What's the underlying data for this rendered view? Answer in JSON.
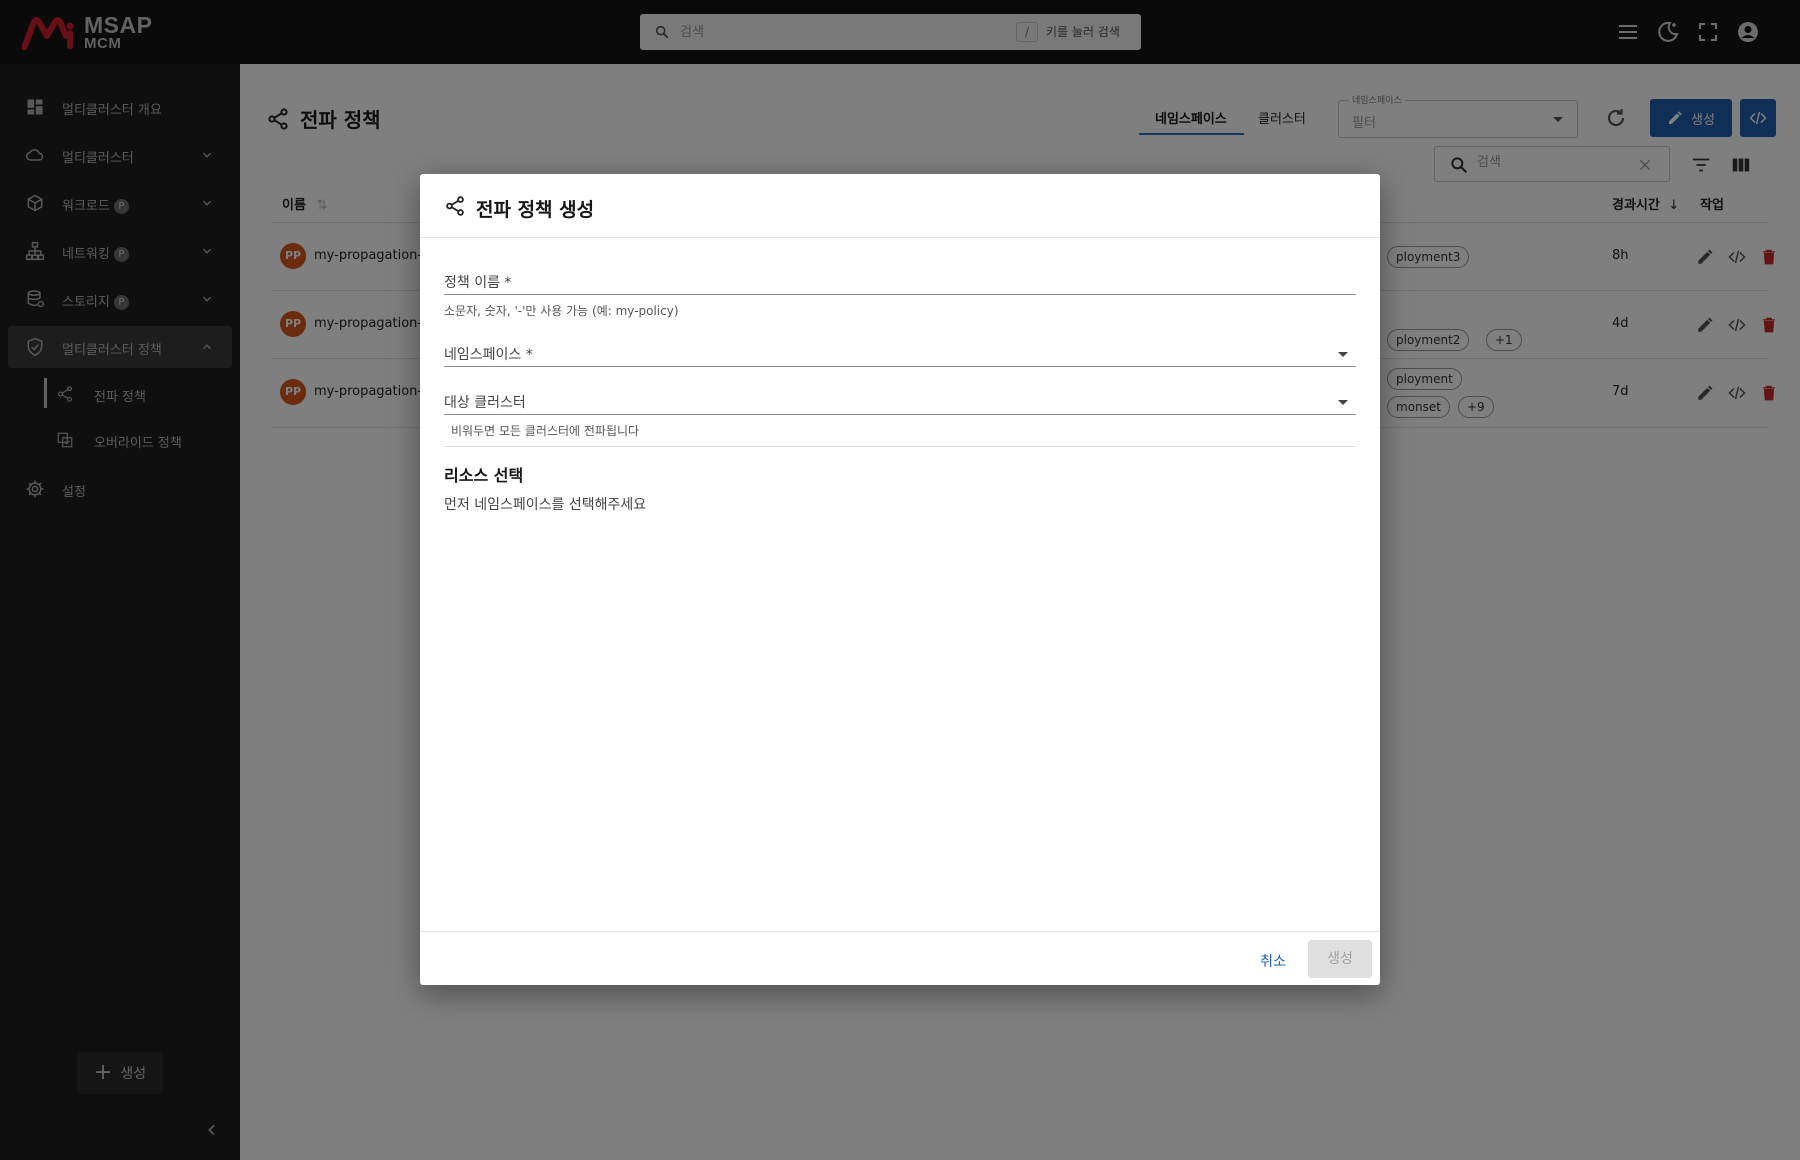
{
  "brand": {
    "line1": "MSAP",
    "line2": "MCM"
  },
  "topbar": {
    "search_placeholder": "검색",
    "shortcut_key": "/",
    "shortcut_hint": "키를 눌러 검색",
    "icons": [
      "menu-icon",
      "dark-mode-icon",
      "fullscreen-icon",
      "account-icon"
    ]
  },
  "sidebar": {
    "items": [
      {
        "label": "멀티클러스터 개요",
        "icon": "dashboard-icon",
        "badge": "",
        "expandable": false
      },
      {
        "label": "멀티클러스터",
        "icon": "cloud-icon",
        "badge": "",
        "expandable": true
      },
      {
        "label": "워크로드",
        "icon": "cube-icon",
        "badge": "P",
        "expandable": true
      },
      {
        "label": "네트워킹",
        "icon": "network-icon",
        "badge": "P",
        "expandable": true
      },
      {
        "label": "스토리지",
        "icon": "storage-icon",
        "badge": "P",
        "expandable": true
      },
      {
        "label": "멀티클러스터 정책",
        "icon": "shield-icon",
        "badge": "",
        "expandable": true,
        "expanded": true,
        "active": true
      }
    ],
    "subitems": [
      {
        "label": "전파 정책",
        "icon": "share-icon",
        "selected": true
      },
      {
        "label": "오버라이드 정책",
        "icon": "override-icon",
        "selected": false
      }
    ],
    "settings_label": "설정",
    "create_label": "생성"
  },
  "page": {
    "title": "전파 정책",
    "tabs": [
      {
        "label": "네임스페이스",
        "selected": true
      },
      {
        "label": "클러스터",
        "selected": false
      }
    ],
    "namespace_filter": {
      "label": "네임스페이스",
      "value": "필터"
    },
    "create_label": "생성",
    "table_search_placeholder": "검색"
  },
  "table": {
    "headers": {
      "name": "이름",
      "age": "경과시간",
      "actions": "작업"
    },
    "rows": [
      {
        "badge": "PP",
        "name": "my-propagation-p",
        "chips": [
          "ployment3"
        ],
        "age": "8h"
      },
      {
        "badge": "PP",
        "name": "my-propagation-s",
        "chips": [
          "ployment2",
          "+1"
        ],
        "age": "4d"
      },
      {
        "badge": "PP",
        "name": "my-propagation-p",
        "chips": [
          "ployment",
          "monset",
          "+9"
        ],
        "age": "7d"
      }
    ]
  },
  "dialog": {
    "title": "전파 정책 생성",
    "policy_name_label": "정책 이름 *",
    "policy_name_helper": "소문자, 숫자, '-'만 사용 가능 (예: my-policy)",
    "namespace_label": "네임스페이스 *",
    "target_cluster_label": "대상 클러스터",
    "target_cluster_helper": "비워두면 모든 클러스터에 전파됩니다",
    "resource_section_title": "리소스 선택",
    "resource_section_text": "먼저 네임스페이스를 선택해주세요",
    "cancel_label": "취소",
    "create_label": "생성"
  },
  "colors": {
    "topbar_bg": "#151515",
    "sidebar_bg": "#1e1e1e",
    "primary": "#1f5fad",
    "brand_red": "#d01f2a",
    "pp_badge": "#d7561b",
    "delete_red": "#c42b2b"
  }
}
